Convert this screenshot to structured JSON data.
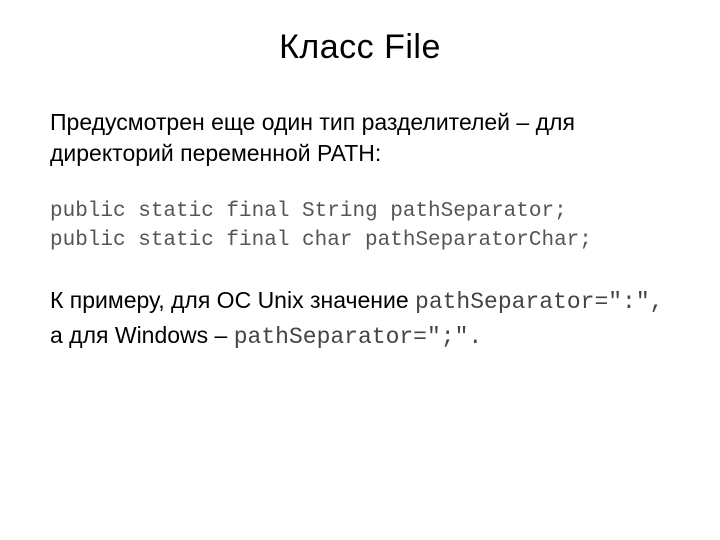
{
  "title": "Класс File",
  "intro": "Предусмотрен еще один тип разделителей – для директорий переменной PATH:",
  "code": {
    "line1": "public static final String pathSeparator;",
    "line2": "public static final char pathSeparatorChar;"
  },
  "example": {
    "part1": "К примеру, для ОС Unix значение ",
    "code1": "pathSeparator=\":\",",
    "part2": " а для Windows – ",
    "code2": "pathSeparator=\";\"."
  }
}
